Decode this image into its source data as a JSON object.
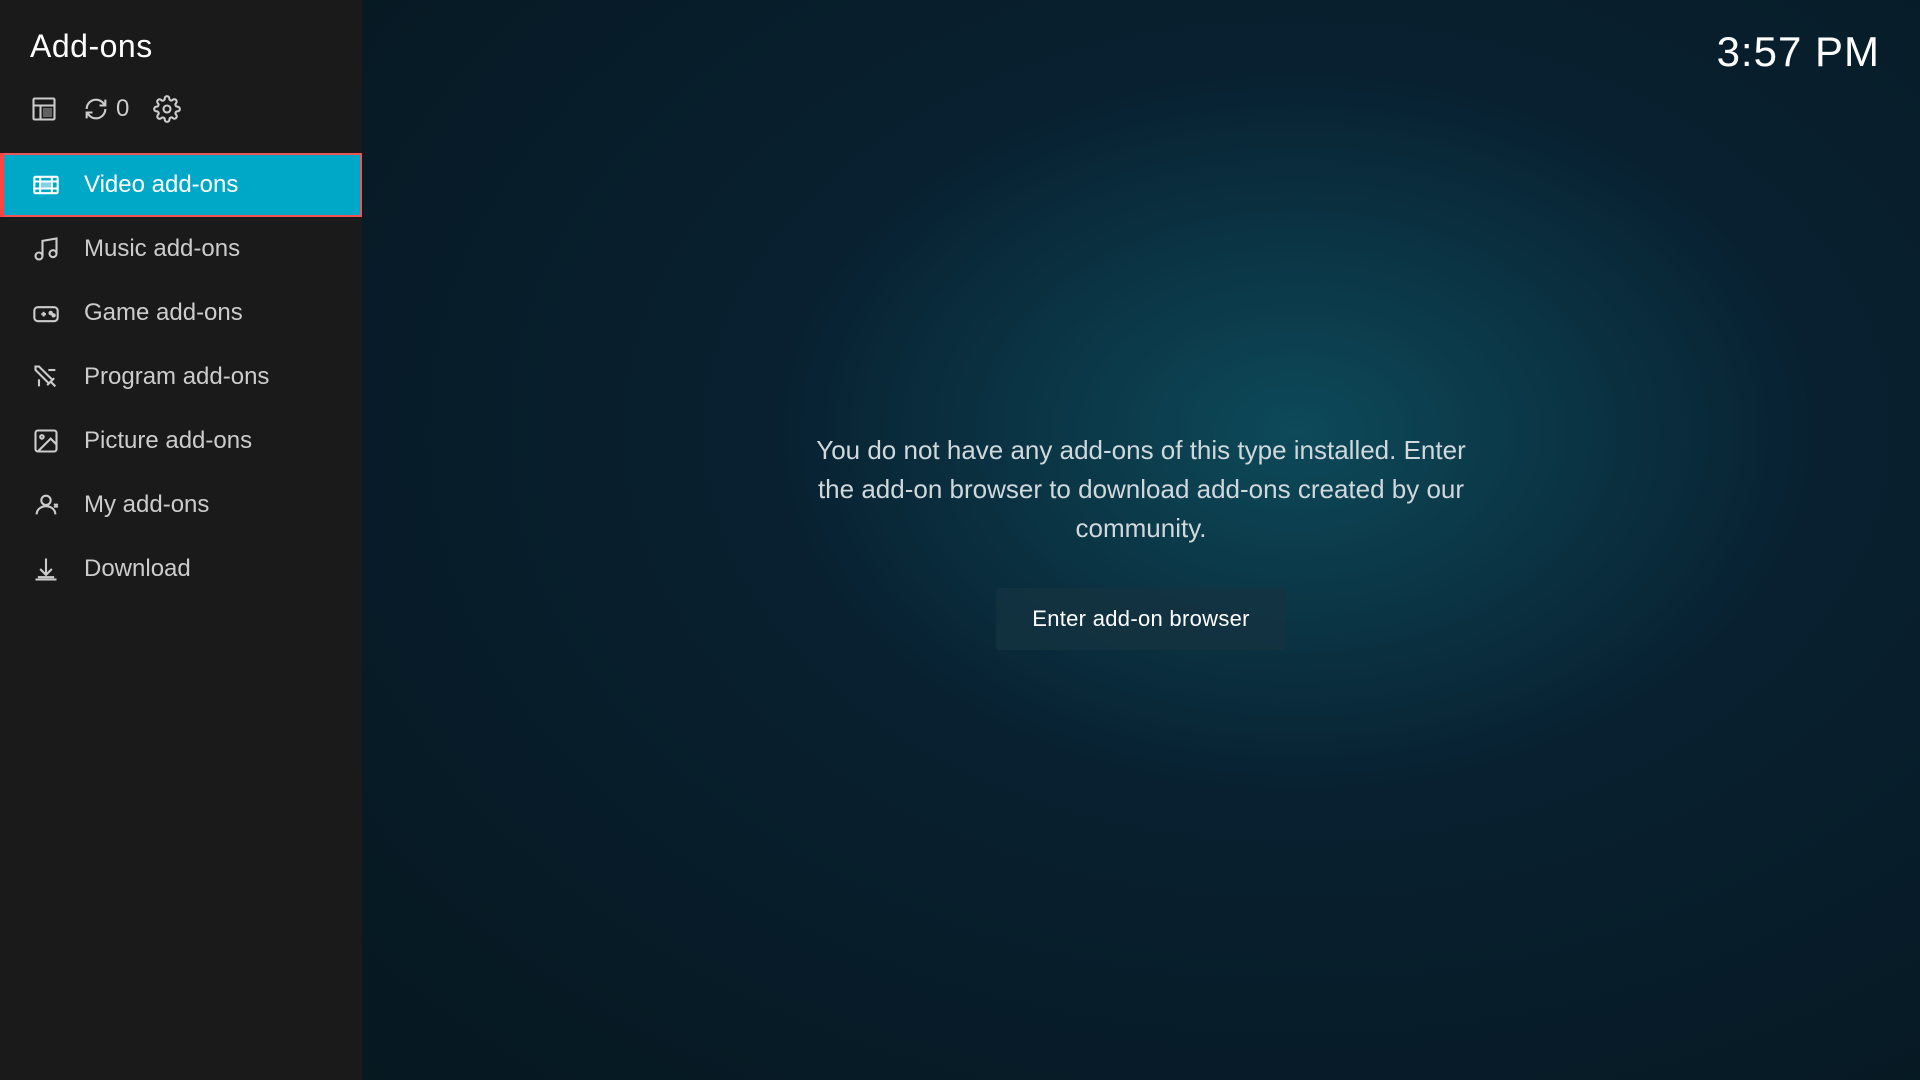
{
  "app": {
    "title": "Add-ons",
    "clock": "3:57 PM"
  },
  "toolbar": {
    "updates_count": "0"
  },
  "sidebar": {
    "items": [
      {
        "id": "video",
        "label": "Video add-ons",
        "active": true,
        "icon": "video-icon"
      },
      {
        "id": "music",
        "label": "Music add-ons",
        "active": false,
        "icon": "music-icon"
      },
      {
        "id": "game",
        "label": "Game add-ons",
        "active": false,
        "icon": "game-icon"
      },
      {
        "id": "program",
        "label": "Program add-ons",
        "active": false,
        "icon": "program-icon"
      },
      {
        "id": "picture",
        "label": "Picture add-ons",
        "active": false,
        "icon": "picture-icon"
      },
      {
        "id": "my",
        "label": "My add-ons",
        "active": false,
        "icon": "my-icon"
      },
      {
        "id": "download",
        "label": "Download",
        "active": false,
        "icon": "download-icon"
      }
    ]
  },
  "main": {
    "empty_message": "You do not have any add-ons of this type installed. Enter the add-on browser to download add-ons created by our community.",
    "enter_browser_label": "Enter add-on browser"
  }
}
